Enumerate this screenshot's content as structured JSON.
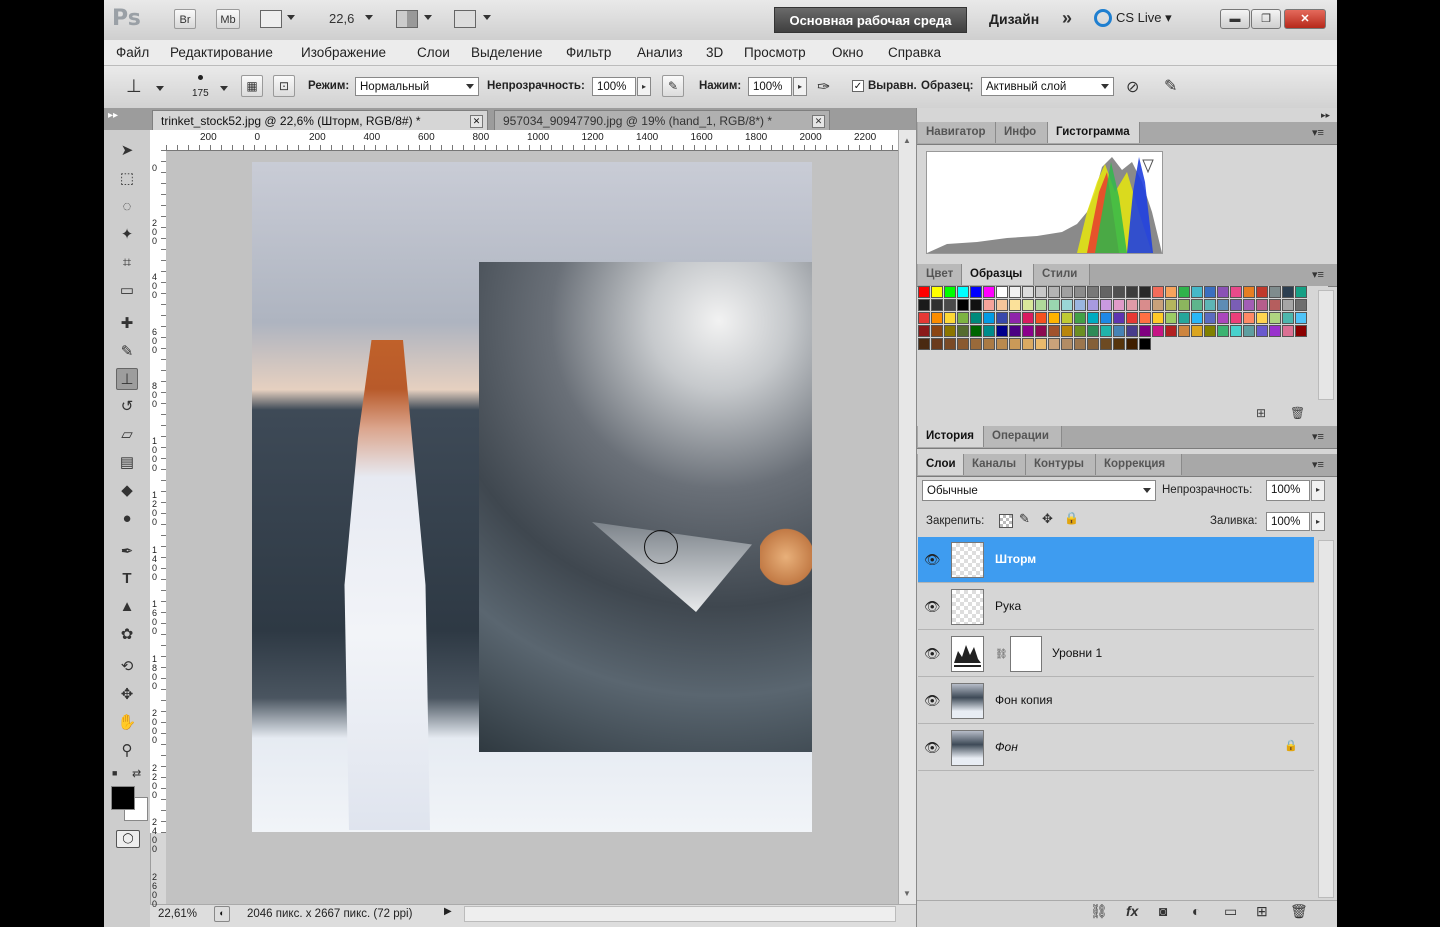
{
  "app": {
    "logo": "Ps",
    "title_buttons": [
      "Br",
      "Mb"
    ],
    "zoom_display": "22,6",
    "workspace_active": "Основная рабочая среда",
    "workspace_design": "Дизайн",
    "workspace_more": "»",
    "cslive": "CS Live",
    "window_buttons": {
      "min": "▬",
      "max": "❐",
      "close": "✕"
    }
  },
  "menu": [
    "Файл",
    "Редактирование",
    "Изображение",
    "Слои",
    "Выделение",
    "Фильтр",
    "Анализ",
    "3D",
    "Просмотр",
    "Окно",
    "Справка"
  ],
  "options": {
    "brush_size": "175",
    "mode_label": "Режим:",
    "mode_value": "Нормальный",
    "opacity_label": "Непрозрачность:",
    "opacity_value": "100%",
    "pressure_label": "Нажим:",
    "pressure_value": "100%",
    "aligned_label": "Выравн.",
    "sample_label": "Образец:",
    "sample_value": "Активный слой"
  },
  "tabs": [
    {
      "label": "trinket_stock52.jpg @ 22,6% (Шторм, RGB/8#) *",
      "active": true
    },
    {
      "label": "957034_90947790.jpg @ 19% (hand_1, RGB/8*) *",
      "active": false
    }
  ],
  "ruler_h": [
    "200",
    "0",
    "200",
    "400",
    "600",
    "800",
    "1000",
    "1200",
    "1400",
    "1600",
    "1800",
    "2000",
    "2200"
  ],
  "ruler_v": [
    "0",
    "2\n0\n0",
    "4\n0\n0",
    "6\n0\n0",
    "8\n0\n0",
    "1\n0\n0\n0",
    "1\n2\n0\n0",
    "1\n4\n0\n0",
    "1\n6\n0\n0",
    "1\n8\n0\n0",
    "2\n0\n0\n0",
    "2\n2\n0\n0",
    "2\n4\n0\n0",
    "2\n6\n0\n0"
  ],
  "status": {
    "zoom": "22,61%",
    "doc_info": "2046 пикс. x 2667 пикс. (72 ppi)"
  },
  "panels": {
    "top_tabs": [
      "Навигатор",
      "Инфо",
      "Гистограмма"
    ],
    "top_active": 2,
    "swatch_tabs": [
      "Цвет",
      "Образцы",
      "Стили"
    ],
    "swatch_active": 1,
    "history_tabs": [
      "История",
      "Операции"
    ],
    "history_active": 0,
    "layer_tabs": [
      "Слои",
      "Каналы",
      "Контуры",
      "Коррекция"
    ],
    "layer_active": 0,
    "blend_mode": "Обычные",
    "opacity_label": "Непрозрачность:",
    "opacity_value": "100%",
    "lock_label": "Закрепить:",
    "fill_label": "Заливка:",
    "fill_value": "100%"
  },
  "layers": [
    {
      "name": "Шторм",
      "selected": true,
      "thumb": "transparent"
    },
    {
      "name": "Рука",
      "selected": false,
      "thumb": "transparent"
    },
    {
      "name": "Уровни 1",
      "selected": false,
      "thumb": "levels"
    },
    {
      "name": "Фон копия",
      "selected": false,
      "thumb": "photo"
    },
    {
      "name": "Фон",
      "selected": false,
      "thumb": "photo",
      "locked": true
    }
  ],
  "swatch_rows": [
    [
      "#ff0000",
      "#ffff00",
      "#00ff00",
      "#00ffff",
      "#0000ff",
      "#ff00ff",
      "#ffffff",
      "#f0f0f0",
      "#dcdcdc",
      "#c8c8c8",
      "#b4b4b4",
      "#a0a0a0",
      "#8c8c8c",
      "#787878",
      "#646464",
      "#505050",
      "#3c3c3c",
      "#282828",
      "#f36c5a",
      "#f7a35c",
      "#2fb34c",
      "#45b8c8",
      "#3a6fc0",
      "#8a52b5",
      "#e84a8a",
      "#e67e22",
      "#c0392b",
      "#7f8c8d",
      "#2c3e50",
      "#16a085"
    ],
    [
      "#1a1a1a",
      "#303030",
      "#4a4a4a",
      "#000000",
      "#111111",
      "#f7a49a",
      "#f7c59a",
      "#fbe19a",
      "#d9e79a",
      "#b0d99a",
      "#9ad6b0",
      "#9ad6d6",
      "#9ab5e0",
      "#a79ae0",
      "#c99ae0",
      "#e09ac9",
      "#e09aa7",
      "#d98c8c",
      "#c9a27a",
      "#b5b55e",
      "#8cb55e",
      "#5eb58c",
      "#5eb5b5",
      "#5e8cb5",
      "#7a5eb5",
      "#a25eb5",
      "#b55e8c",
      "#b55e5e",
      "#a6a6a6",
      "#6e6e6e"
    ],
    [
      "#e53935",
      "#fb8c00",
      "#fdd835",
      "#7cb342",
      "#00897b",
      "#039be5",
      "#3949ab",
      "#8e24aa",
      "#d81b60",
      "#f4511e",
      "#ffb300",
      "#c0ca33",
      "#43a047",
      "#00acc1",
      "#1e88e5",
      "#5e35b1",
      "#e53935",
      "#ff7043",
      "#ffca28",
      "#9ccc65",
      "#26a69a",
      "#29b6f6",
      "#5c6bc0",
      "#ab47bc",
      "#ec407a",
      "#ff8a65",
      "#ffd54f",
      "#aed581",
      "#4db6ac",
      "#4fc3f7"
    ],
    [
      "#8b1a1a",
      "#8b4513",
      "#8b7500",
      "#556b2f",
      "#006400",
      "#008b8b",
      "#00008b",
      "#4b0082",
      "#8b008b",
      "#8b0a50",
      "#a0522d",
      "#b8860b",
      "#6b8e23",
      "#2e8b57",
      "#20b2aa",
      "#4682b4",
      "#483d8b",
      "#800080",
      "#c71585",
      "#b22222",
      "#cd853f",
      "#daa520",
      "#808000",
      "#3cb371",
      "#48d1cc",
      "#5f9ea0",
      "#6a5acd",
      "#9932cc",
      "#db7093",
      "#8b0000"
    ],
    [
      "#4a2a12",
      "#6b3a1c",
      "#7a4a26",
      "#8a5a30",
      "#9a6a3a",
      "#aa7a44",
      "#ba8a4e",
      "#ca9a58",
      "#daaa62",
      "#eaba6c",
      "#c9a27a",
      "#b28c64",
      "#9b764e",
      "#846038",
      "#6d4a22",
      "#56340c",
      "#3f1e00",
      "#000000"
    ]
  ]
}
